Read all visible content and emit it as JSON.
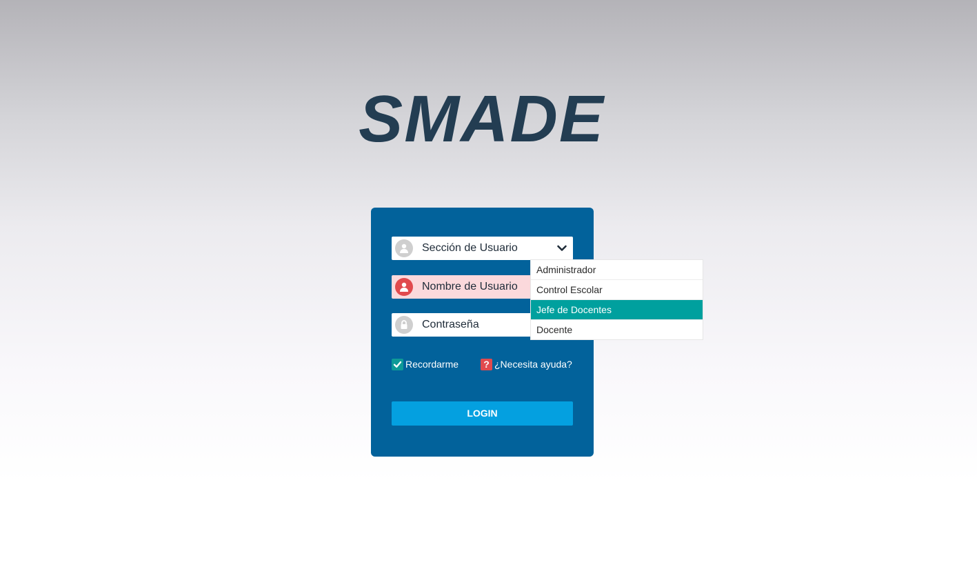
{
  "app": {
    "logo_text": "SMADE"
  },
  "form": {
    "section_select": {
      "selected_label": "Sección de Usuario",
      "icon": "user-icon",
      "options": [
        {
          "label": "Administrador",
          "selected": false
        },
        {
          "label": "Control Escolar",
          "selected": false
        },
        {
          "label": "Jefe de Docentes",
          "selected": true
        },
        {
          "label": "Docente",
          "selected": false
        }
      ]
    },
    "username": {
      "placeholder": "Nombre de Usuario",
      "value": "",
      "icon": "user-icon",
      "state": "error"
    },
    "password": {
      "placeholder": "Contraseña",
      "value": "",
      "icon": "lock-icon"
    },
    "remember": {
      "label": "Recordarme",
      "checked": true,
      "icon": "checkmark-icon"
    },
    "help": {
      "badge": "?",
      "label": "¿Necesita ayuda?"
    },
    "login_button": {
      "label": "LOGIN"
    }
  },
  "colors": {
    "logo": "#233d52",
    "panel": "#02629b",
    "button": "#04a0e0",
    "selected_option": "#00a09e",
    "error": "#e14a4e",
    "error_field_bg": "#fbd9dc",
    "checkbox": "#0e9a97"
  }
}
